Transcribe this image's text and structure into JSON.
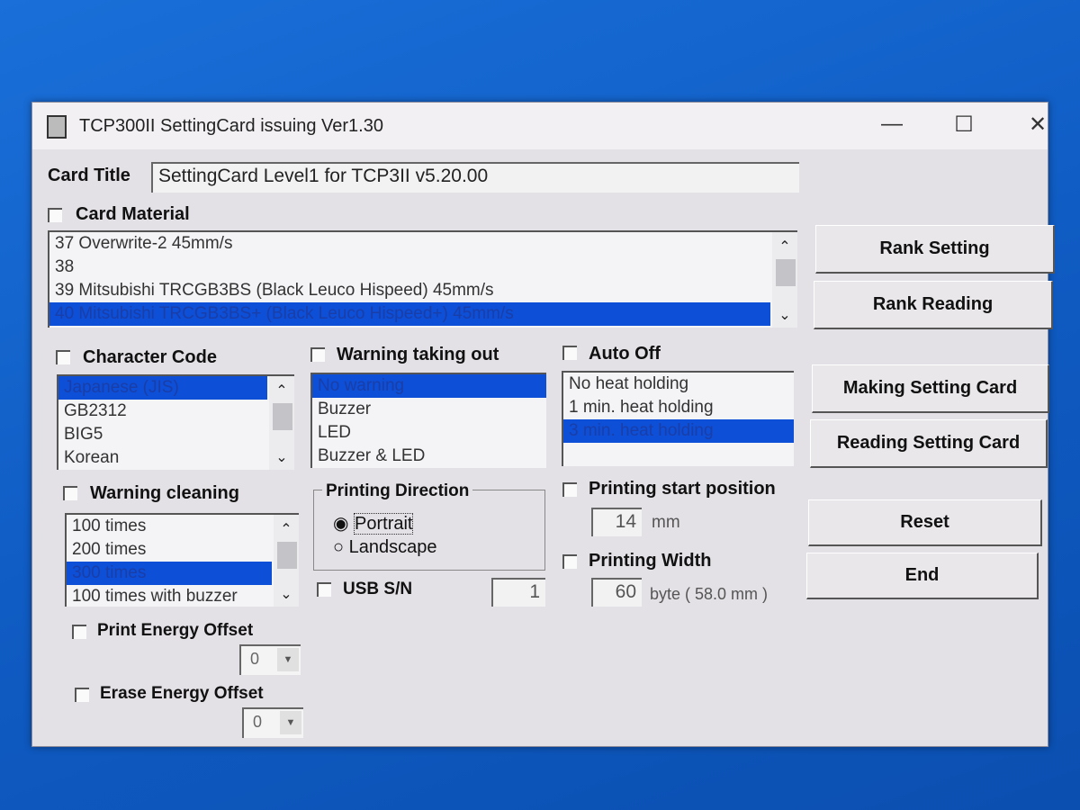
{
  "window": {
    "title": "TCP300II SettingCard issuing Ver1.30",
    "minimize": "—",
    "maximize": "☐",
    "close": "✕"
  },
  "card_title": {
    "label": "Card Title",
    "value": "SettingCard Level1 for TCP3II v5.20.00"
  },
  "card_material": {
    "label": "Card Material",
    "items": [
      "37  Overwrite-2 45mm/s",
      "38",
      "39  Mitsubishi TRCGB3BS  (Black Leuco Hispeed) 45mm/s",
      "40  Mitsubishi TRCGB3BS+ (Black Leuco Hispeed+) 45mm/s"
    ],
    "selected": 3
  },
  "character_code": {
    "label": "Character Code",
    "items": [
      "Japanese (JIS)",
      "GB2312",
      "BIG5",
      "Korean"
    ],
    "selected": 0
  },
  "warning_taking_out": {
    "label": "Warning taking out",
    "items": [
      "No warning",
      "Buzzer",
      "LED",
      "Buzzer & LED"
    ],
    "selected": 0
  },
  "auto_off": {
    "label": "Auto Off",
    "items": [
      "No heat holding",
      "1 min. heat holding",
      "3 min. heat holding"
    ],
    "selected": 2
  },
  "warning_cleaning": {
    "label": "Warning cleaning",
    "items": [
      "100 times",
      "200 times",
      "300 times",
      "100 times with buzzer"
    ],
    "selected": 2
  },
  "printing_direction": {
    "label": "Printing Direction",
    "portrait": "Portrait",
    "landscape": "Landscape",
    "selected": "Portrait"
  },
  "usb_sn": {
    "label": "USB S/N",
    "value": "1"
  },
  "printing_start_position": {
    "label": "Printing start position",
    "value": "14",
    "unit": "mm"
  },
  "printing_width": {
    "label": "Printing Width",
    "value": "60",
    "unit": "byte ( 58.0 mm )"
  },
  "print_energy_offset": {
    "label": "Print Energy Offset",
    "value": "0"
  },
  "erase_energy_offset": {
    "label": "Erase Energy Offset",
    "value": "0"
  },
  "buttons": {
    "rank_setting": "Rank Setting",
    "rank_reading": "Rank Reading",
    "making": "Making Setting Card",
    "reading": "Reading Setting Card",
    "reset": "Reset",
    "end": "End"
  },
  "colors": {
    "selection": "#0d4fd6",
    "desktop": "#1a6fd8"
  }
}
